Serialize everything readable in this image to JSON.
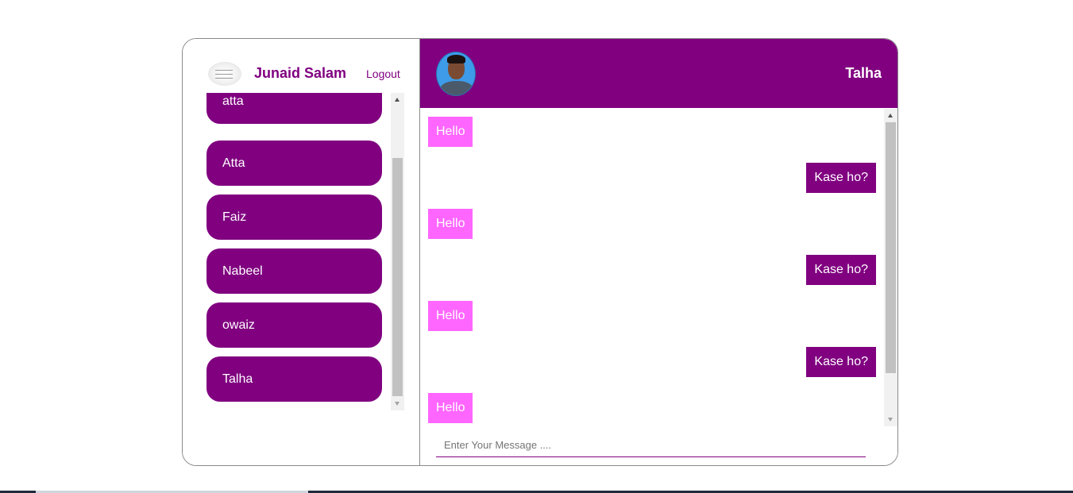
{
  "colors": {
    "accent": "#800080",
    "incoming_bubble": "#ff66ff",
    "outgoing_bubble": "#800080",
    "text_on_accent": "#ffffff"
  },
  "sidebar": {
    "user_name": "Junaid Salam",
    "logout_label": "Logout",
    "contacts": [
      {
        "name": "atta"
      },
      {
        "name": "Atta"
      },
      {
        "name": "Faiz"
      },
      {
        "name": "Nabeel"
      },
      {
        "name": "owaiz"
      },
      {
        "name": "Talha"
      }
    ]
  },
  "chat": {
    "peer_name": "Talha",
    "messages": [
      {
        "direction": "in",
        "text": "Hello"
      },
      {
        "direction": "out",
        "text": "Kase ho?"
      },
      {
        "direction": "in",
        "text": "Hello"
      },
      {
        "direction": "out",
        "text": "Kase ho?"
      },
      {
        "direction": "in",
        "text": "Hello"
      },
      {
        "direction": "out",
        "text": "Kase ho?"
      },
      {
        "direction": "in",
        "text": "Hello"
      }
    ],
    "input": {
      "placeholder": "Enter Your Message ....",
      "value": ""
    }
  }
}
